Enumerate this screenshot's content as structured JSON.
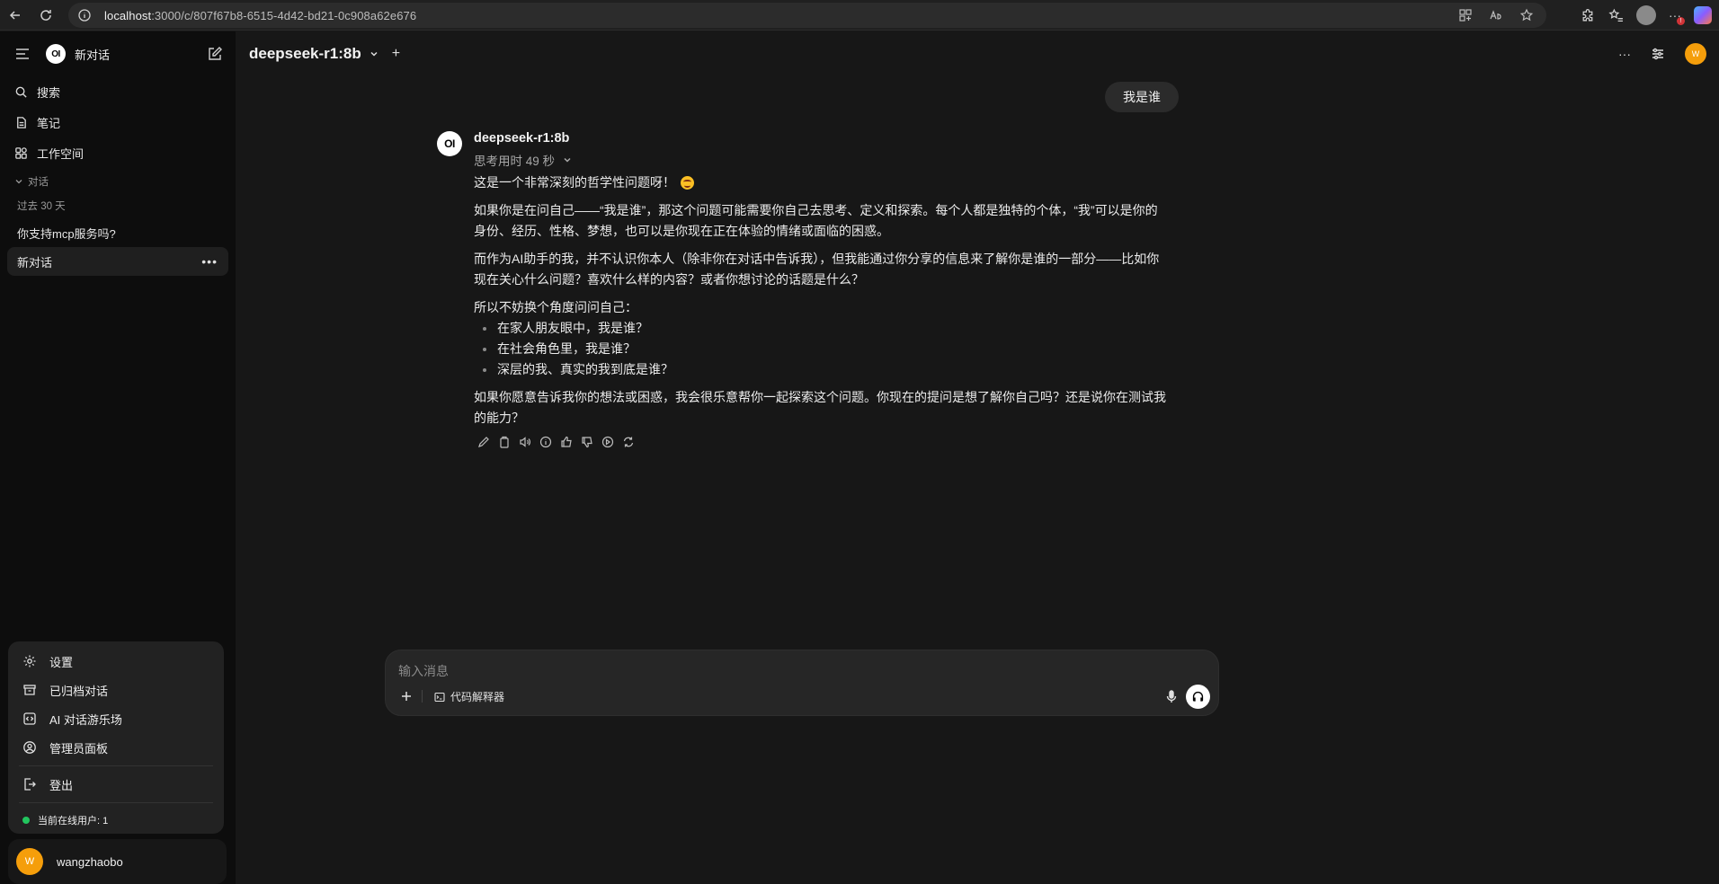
{
  "browser": {
    "url_host": "localhost",
    "url_rest": ":3000/c/807f67b8-6515-4d42-bd21-0c908a62e676"
  },
  "sidebar": {
    "title": "新对话",
    "items": [
      {
        "label": "搜索",
        "icon": "search-icon"
      },
      {
        "label": "笔记",
        "icon": "notes-icon"
      },
      {
        "label": "工作空间",
        "icon": "workspace-icon"
      }
    ],
    "section_label": "对话",
    "time_group": "过去 30 天",
    "chats": [
      {
        "label": "你支持mcp服务吗?"
      },
      {
        "label": "新对话"
      }
    ],
    "chat_more": "•••"
  },
  "user_menu": {
    "items": [
      {
        "label": "设置",
        "icon": "settings-icon"
      },
      {
        "label": "已归档对话",
        "icon": "archive-icon"
      },
      {
        "label": "AI 对话游乐场",
        "icon": "code-icon"
      },
      {
        "label": "管理员面板",
        "icon": "user-circle-icon"
      }
    ],
    "logout": "登出",
    "online_users": "当前在线用户: 1"
  },
  "user": {
    "avatar_letter": "W",
    "name": "wangzhaobo",
    "avatar_color": "#f59e0b"
  },
  "header": {
    "model": "deepseek-r1:8b",
    "more": "···",
    "avatar_letter": "W"
  },
  "conversation": {
    "user_message": "我是谁",
    "assistant": {
      "logo": "OI",
      "name": "deepseek-r1:8b",
      "thinking": "思考用时 49 秒",
      "p1": "这是一个非常深刻的哲学性问题呀！",
      "p2": "如果你是在问自己——“我是谁”，那这个问题可能需要你自己去思考、定义和探索。每个人都是独特的个体，“我”可以是你的身份、经历、性格、梦想，也可以是你现在正在体验的情绪或面临的困惑。",
      "p3": "而作为AI助手的我，并不认识你本人（除非你在对话中告诉我），但我能通过你分享的信息来了解你是谁的一部分——比如你现在关心什么问题？喜欢什么样的内容？或者你想讨论的话题是什么？",
      "p4": "所以不妨换个角度问问自己：",
      "bullets": [
        "在家人朋友眼中，我是谁？",
        "在社会角色里，我是谁？",
        "深层的我、真实的我到底是谁？"
      ],
      "p5": "如果你愿意告诉我你的想法或困惑，我会很乐意帮你一起探索这个问题。你现在的提问是想了解你自己吗？还是说你在测试我的能力？"
    }
  },
  "composer": {
    "placeholder": "输入消息",
    "code_interpreter": "代码解释器"
  }
}
